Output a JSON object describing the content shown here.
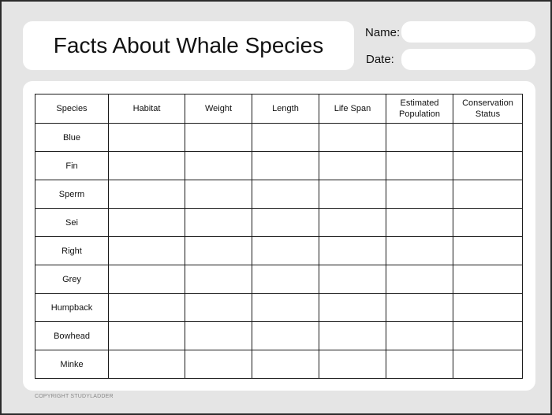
{
  "worksheet": {
    "title": "Facts About Whale Species",
    "name_label": "Name:",
    "date_label": "Date:",
    "copyright": "COPYRIGHT STUDYLADDER"
  },
  "table": {
    "headers": [
      "Species",
      "Habitat",
      "Weight",
      "Length",
      "Life Span",
      "Estimated Population",
      "Conservation Status"
    ],
    "rows": [
      "Blue",
      "Fin",
      "Sperm",
      "Sei",
      "Right",
      "Grey",
      "Humpback",
      "Bowhead",
      "Minke"
    ]
  }
}
